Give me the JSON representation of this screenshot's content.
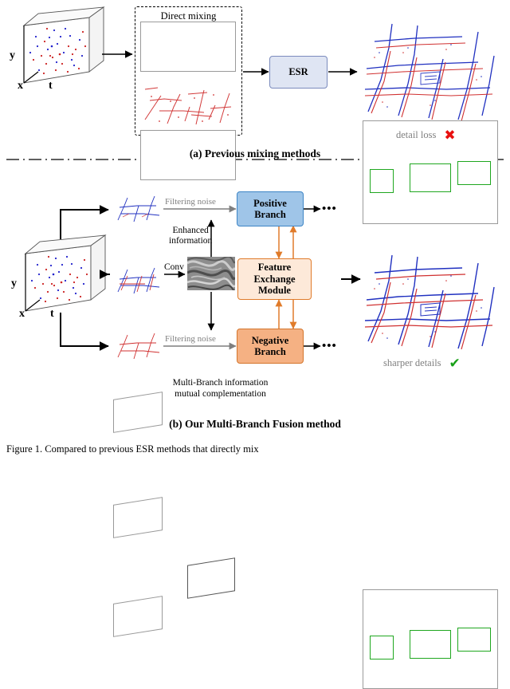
{
  "figure": {
    "panel_a_caption": "(a) Previous  mixing methods",
    "panel_b_caption": "(b) Our Multi-Branch Fusion method",
    "bottom_caption": "Figure 1.   Compared to previous ESR methods that directly mix"
  },
  "panel_a": {
    "direct_mixing_label": "Direct mixing",
    "esr_label": "ESR",
    "detail_loss_label": "detail loss",
    "detail_loss_mark": "✖",
    "axis_y": "y",
    "axis_x": "x",
    "axis_t": "t"
  },
  "panel_b": {
    "filtering_noise_top": "Filtering noise",
    "filtering_noise_bottom": "Filtering noise",
    "enhanced_information_line1": "Enhanced",
    "enhanced_information_line2": "information",
    "conv_label": "Conv",
    "positive_branch_line1": "Positive",
    "positive_branch_line2": "Branch",
    "negative_branch_line1": "Negative",
    "negative_branch_line2": "Branch",
    "fem_line1": "Feature",
    "fem_line2": "Exchange",
    "fem_line3": "Module",
    "multi_branch_line1": "Multi-Branch information",
    "multi_branch_line2": "mutual complementation",
    "dots_top": "•••",
    "dots_bottom": "•••",
    "sharper_details_label": "sharper details",
    "sharper_details_mark": "✔",
    "axis_y": "y",
    "axis_x": "x",
    "axis_t": "t"
  },
  "colors": {
    "positive_branch": "#9fc5e8",
    "negative_branch": "#f5b183",
    "feature_exchange_module": "#fde9d9",
    "esr": "#dfe5f3",
    "region_highlight": "#1fa71f",
    "fail_mark": "#e8100f",
    "success_mark": "#18a018",
    "event_positive": "#e03030",
    "event_negative": "#2030c0",
    "panel_bg": "#dce6f5"
  }
}
